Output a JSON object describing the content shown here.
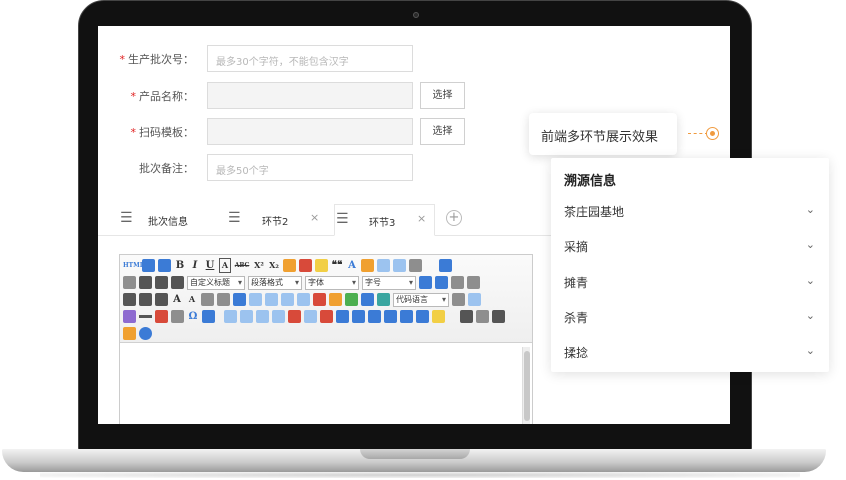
{
  "form": {
    "fields": [
      {
        "label": "生产批次号：",
        "required": true,
        "placeholder": "最多30个字符，不能包含汉字",
        "value": "",
        "has_button": false
      },
      {
        "label": "产品名称：",
        "required": true,
        "placeholder": "",
        "value": "",
        "has_button": true,
        "button_label": "选择"
      },
      {
        "label": "扫码模板：",
        "required": true,
        "placeholder": "",
        "value": "",
        "has_button": true,
        "button_label": "选择"
      },
      {
        "label": "批次备注：",
        "required": false,
        "placeholder": "最多50个字",
        "value": "",
        "has_button": false
      }
    ],
    "required_mark": "*"
  },
  "tabs": [
    {
      "label": "批次信息",
      "active": false,
      "closable": false
    },
    {
      "label": "环节2",
      "active": false,
      "closable": true
    },
    {
      "label": "环节3",
      "active": true,
      "closable": true
    }
  ],
  "tab_close_glyph": "×",
  "add_tab_glyph": "+",
  "editor": {
    "toolbar_selects": {
      "custom_title": "自定义标题",
      "paragraph_format": "段落格式",
      "font_family": "字体",
      "font_size": "字号",
      "code_language": "代码语言"
    },
    "format_buttons": {
      "bold": "B",
      "italic": "I",
      "underline": "U",
      "html": "HTML",
      "font_color": "A",
      "superscript": "X²",
      "subscript": "X₂",
      "strikethrough": "ABC",
      "quote": "❝❝",
      "omega": "Ω"
    }
  },
  "callout": {
    "text": "前端多环节展示效果",
    "accent_color": "#f09a3e"
  },
  "panel": {
    "title": "溯源信息",
    "items": [
      {
        "label": "茶庄园基地"
      },
      {
        "label": "采摘"
      },
      {
        "label": "摊青"
      },
      {
        "label": "杀青"
      },
      {
        "label": "揉捻"
      }
    ],
    "chevron_glyph": "⌄"
  }
}
